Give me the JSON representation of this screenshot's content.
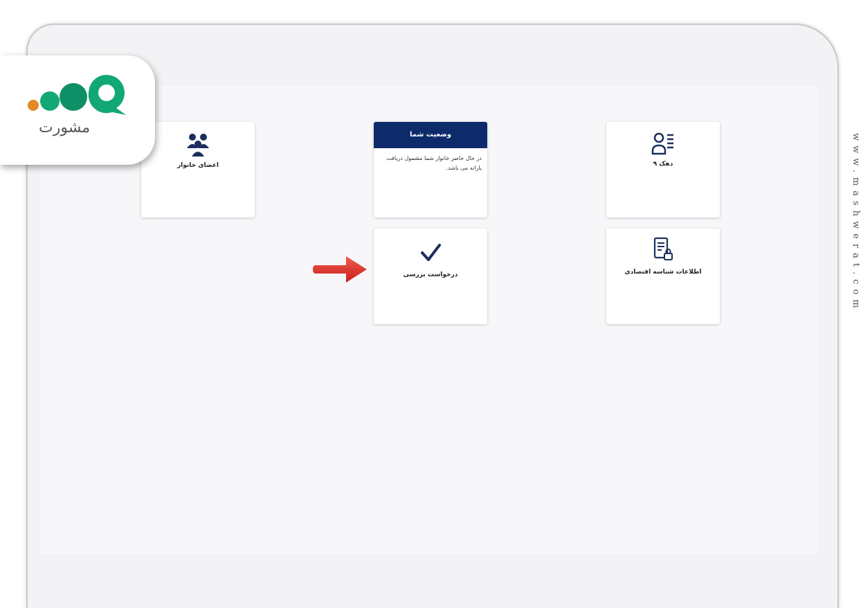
{
  "brand": {
    "logo_text": "مشورت"
  },
  "cards": {
    "family_members": {
      "label": "اعضای خانوار",
      "icon": "family-group-icon"
    },
    "your_status": {
      "title": "وضعیت شما",
      "message": "در حال حاضر خانوار شما مشمول دریافت یارانه می باشد."
    },
    "decile": {
      "label": "دهک ۹",
      "icon": "profile-list-icon"
    },
    "review_request": {
      "label": "درخواست بررسی",
      "icon": "checkmark-icon"
    },
    "economic_id": {
      "label": "اطلاعات شناسه اقتصادی",
      "icon": "document-lock-icon"
    }
  },
  "watermark": {
    "text": "www.mashwerat.com"
  },
  "colors": {
    "header_navy": "#0d2a6b",
    "icon_navy": "#1b2f5e",
    "arrow_red": "#e0302a",
    "brand_green": "#12a874"
  }
}
